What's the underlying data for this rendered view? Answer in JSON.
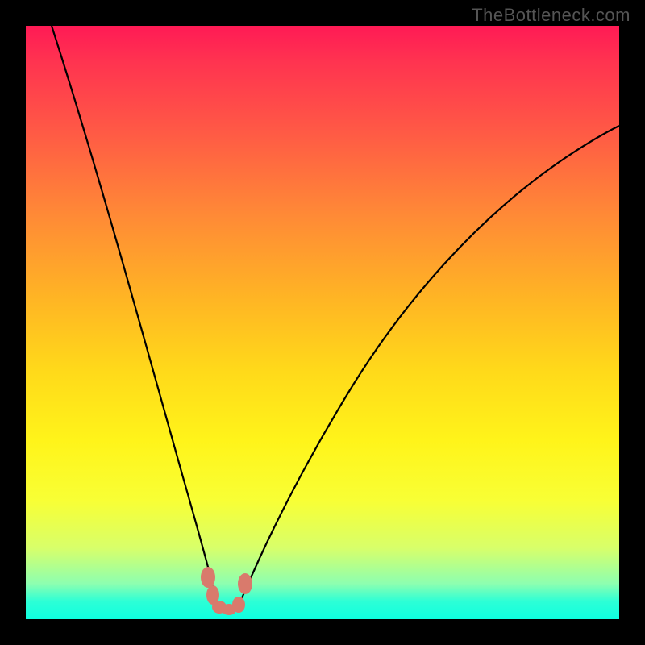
{
  "attribution": "TheBottleneck.com",
  "chart_data": {
    "type": "line",
    "title": "",
    "xlabel": "",
    "ylabel": "",
    "xlim": [
      0,
      100
    ],
    "ylim": [
      0,
      100
    ],
    "series": [
      {
        "name": "left-branch",
        "x": [
          4,
          8,
          12,
          16,
          20,
          24,
          27,
          29,
          30,
          31,
          31.5
        ],
        "values": [
          100,
          85,
          70,
          55,
          40,
          27,
          17,
          10,
          6,
          3,
          2
        ]
      },
      {
        "name": "right-branch",
        "x": [
          35,
          36,
          38,
          42,
          48,
          56,
          66,
          78,
          90,
          100
        ],
        "values": [
          2,
          3,
          6,
          12,
          22,
          35,
          50,
          63,
          74,
          82
        ]
      }
    ],
    "annotations": [
      {
        "name": "minimum-marker",
        "x": 33,
        "y": 1
      }
    ]
  },
  "colors": {
    "gradient_top": "#ff1a55",
    "gradient_mid": "#ffd91a",
    "gradient_bottom": "#0effe0",
    "curve": "#000000",
    "marker": "#d97a6c"
  }
}
